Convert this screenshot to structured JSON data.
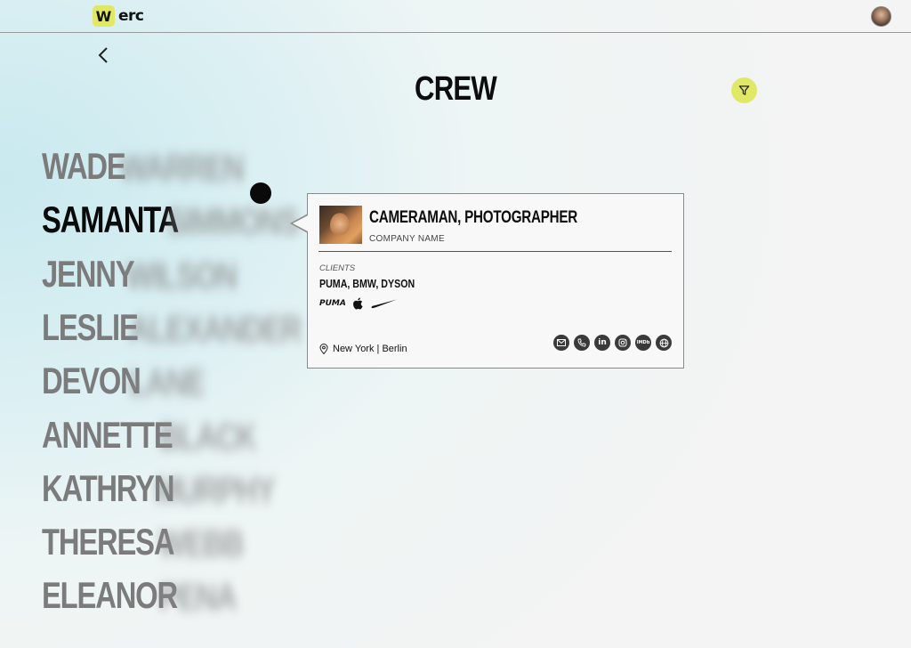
{
  "header": {
    "logo_mark": "W",
    "logo_text": "erc"
  },
  "page": {
    "title": "CREW"
  },
  "crew": [
    {
      "first": "WADE",
      "last": "WARREN",
      "active": false
    },
    {
      "first": "SAMANTA",
      "last": "SIMMONS",
      "active": true
    },
    {
      "first": "JENNY",
      "last": "WILSON",
      "active": false
    },
    {
      "first": "LESLIE",
      "last": "ALEXANDER",
      "active": false
    },
    {
      "first": "DEVON",
      "last": "LANE",
      "active": false
    },
    {
      "first": "ANNETTE",
      "last": "BLACK",
      "active": false
    },
    {
      "first": "KATHRYN",
      "last": "MURPHY",
      "active": false
    },
    {
      "first": "THERESA",
      "last": "WEBB",
      "active": false
    },
    {
      "first": "ELEANOR",
      "last": "PENA",
      "active": false
    }
  ],
  "card": {
    "role": "CAMERAMAN, PHOTOGRAPHER",
    "company": "COMPANY NAME",
    "clients_label": "CLIENTS",
    "clients": "PUMA, BMW, DYSON",
    "brands": [
      "puma-logo",
      "apple-logo",
      "nike-logo"
    ],
    "puma_text": "PUMA",
    "location": "New York | Berlin",
    "social": [
      "email-icon",
      "phone-icon",
      "linkedin-icon",
      "instagram-icon",
      "imdb-icon",
      "globe-icon"
    ],
    "linkedin_text": "in",
    "imdb_text": "IMDb"
  },
  "colors": {
    "accent": "#e1e865",
    "text_active": "#0a0a0a",
    "text_inactive": "#7b7b7b",
    "icon_bg": "#3a3a3a"
  }
}
